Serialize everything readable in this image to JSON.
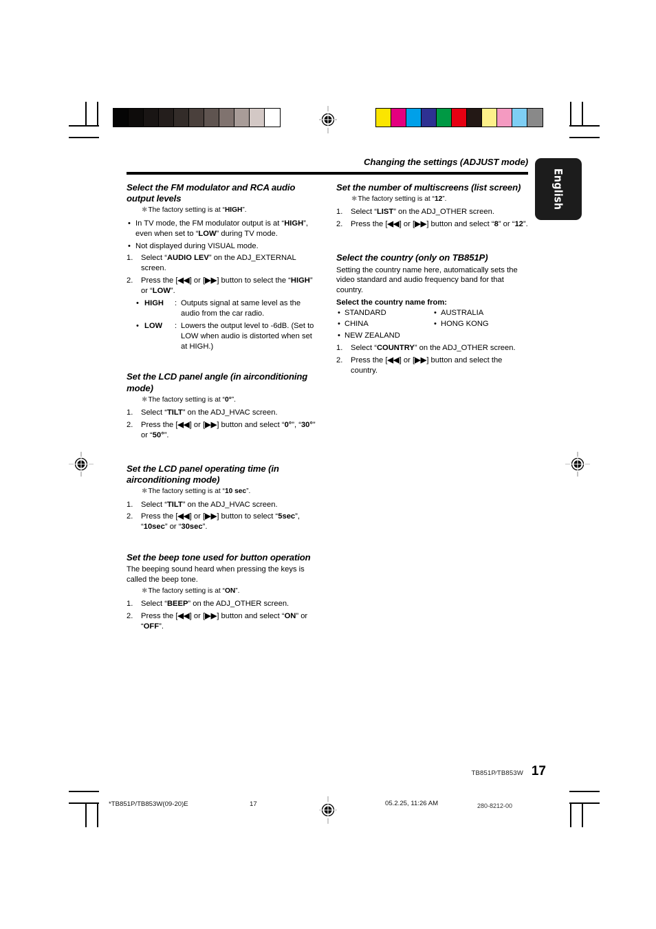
{
  "header": {
    "running_title": "Changing the settings (ADJUST mode)",
    "language_tab": "English"
  },
  "calibration": {
    "gray_bar_colors": [
      "#050505",
      "#0e0c0b",
      "#191514",
      "#241e1c",
      "#332c29",
      "#4a403c",
      "#5f5450",
      "#80736f",
      "#a89c98",
      "#d3c8c5",
      "#ffffff"
    ],
    "color_bar_colors": [
      "#fbe500",
      "#e4007f",
      "#00a0e9",
      "#2e3192",
      "#009944",
      "#e60012",
      "#231815",
      "#fdf08a",
      "#f49ac1",
      "#7ecef4",
      "#898989"
    ]
  },
  "left_column": {
    "section1": {
      "heading": "Select the FM modulator and RCA audio output levels",
      "note": "The factory setting is at “HIGH”.",
      "note_parts": {
        "prefix": "The factory setting is at “",
        "bold": "HIGH",
        "suffix": "”."
      },
      "bullets": [
        {
          "prefix": "In TV mode, the FM modulator output is at “",
          "b1": "HIGH",
          "mid": "”, even when set to “",
          "b2": "LOW",
          "suffix": "” during TV mode."
        },
        {
          "plain": "Not displayed during VISUAL mode."
        }
      ],
      "steps": [
        {
          "n": "1.",
          "prefix": "Select “",
          "bold": "AUDIO LEV",
          "suffix": "” on the ADJ_EXTERNAL screen."
        },
        {
          "n": "2.",
          "prefix": "Press the [",
          "btn1": "◀◀",
          "mid1": "] or [",
          "btn2": "▶▶",
          "mid2": "] button to select the “",
          "b1": "HIGH",
          "mid3": "” or “",
          "b2": "LOW",
          "suffix": "”."
        }
      ],
      "definitions": [
        {
          "term": "HIGH",
          "sep": ":",
          "body": "Outputs signal at same level as the audio from the car radio."
        },
        {
          "term": "LOW",
          "sep": ":",
          "body": "Lowers the output level to -6dB. (Set to LOW when audio is distorted when set at HIGH.)"
        }
      ]
    },
    "section2": {
      "heading": "Set the LCD panel angle (in airconditioning mode)",
      "note_parts": {
        "prefix": "The factory setting is at “",
        "bold": "0°",
        "suffix": "”."
      },
      "steps": [
        {
          "n": "1.",
          "prefix": "Select “",
          "bold": "TILT",
          "suffix": "” on the ADJ_HVAC screen."
        },
        {
          "n": "2.",
          "prefix": "Press the [",
          "btn1": "◀◀",
          "mid1": "] or [",
          "btn2": "▶▶",
          "mid2": "] button and select “",
          "b1": "0°",
          "mid3": "”, “",
          "b2": "30°",
          "mid4": "” or “",
          "b3": "50°",
          "suffix": "”."
        }
      ]
    },
    "section3": {
      "heading": "Set the LCD panel operating time (in airconditioning mode)",
      "note_parts": {
        "prefix": "The factory setting is at “",
        "bold": "10 sec",
        "suffix": "”."
      },
      "steps": [
        {
          "n": "1.",
          "prefix": "Select “",
          "bold": "TILT",
          "suffix": "” on the ADJ_HVAC screen."
        },
        {
          "n": "2.",
          "prefix": "Press the [",
          "btn1": "◀◀",
          "mid1": "] or [",
          "btn2": "▶▶",
          "mid2": "] button to select “",
          "b1": "5sec",
          "mid3": "”, “",
          "b2": "10sec",
          "mid4": "” or “",
          "b3": "30sec",
          "suffix": "”."
        }
      ]
    },
    "section4": {
      "heading": "Set the beep tone used for button operation",
      "intro": "The beeping sound heard when pressing the keys is called the beep tone.",
      "note_parts": {
        "prefix": "The factory setting is at “",
        "bold": "ON",
        "suffix": "”."
      },
      "steps": [
        {
          "n": "1.",
          "prefix": "Select “",
          "bold": "BEEP",
          "suffix": "” on the ADJ_OTHER screen."
        },
        {
          "n": "2.",
          "prefix": "Press the [",
          "btn1": "◀◀",
          "mid1": "] or [",
          "btn2": "▶▶",
          "mid2": "] button and select “",
          "b1": "ON",
          "mid3": "” or “",
          "b2": "OFF",
          "suffix": "”."
        }
      ]
    }
  },
  "right_column": {
    "section1": {
      "heading": "Set the number of multiscreens (list screen)",
      "note_parts": {
        "prefix": "The factory setting is at “",
        "bold": "12",
        "suffix": "”."
      },
      "steps": [
        {
          "n": "1.",
          "prefix": "Select “",
          "bold": "LIST",
          "suffix": "” on the ADJ_OTHER screen."
        },
        {
          "n": "2.",
          "prefix": "Press the [",
          "btn1": "◀◀",
          "mid1": "] or [",
          "btn2": "▶▶",
          "mid2": "] button and select “",
          "b1": "8",
          "mid3": "” or “",
          "b2": "12",
          "suffix": "”."
        }
      ]
    },
    "section2": {
      "heading": "Select the country (only on TB851P)",
      "intro": "Setting the country name here, automatically sets the video standard and audio frequency band for that country.",
      "list_label": "Select the country name from:",
      "countries": [
        "STANDARD",
        "AUSTRALIA",
        "CHINA",
        "HONG KONG",
        "NEW ZEALAND"
      ],
      "steps": [
        {
          "n": "1.",
          "prefix": "Select “",
          "bold": "COUNTRY",
          "suffix": "” on the ADJ_OTHER screen."
        },
        {
          "n": "2.",
          "prefix": "Press the [",
          "btn1": "◀◀",
          "mid1": "] or [",
          "btn2": "▶▶",
          "mid2": "] button and select the country."
        }
      ]
    }
  },
  "footer": {
    "model_label": "TB851P⁄TB853W",
    "page_number": "17",
    "file_name": "*TB851P/TB853W(09-20)E",
    "strip_page": "17",
    "timestamp": "05.2.25, 11:26 AM",
    "doc_code": "280-8212-00"
  }
}
